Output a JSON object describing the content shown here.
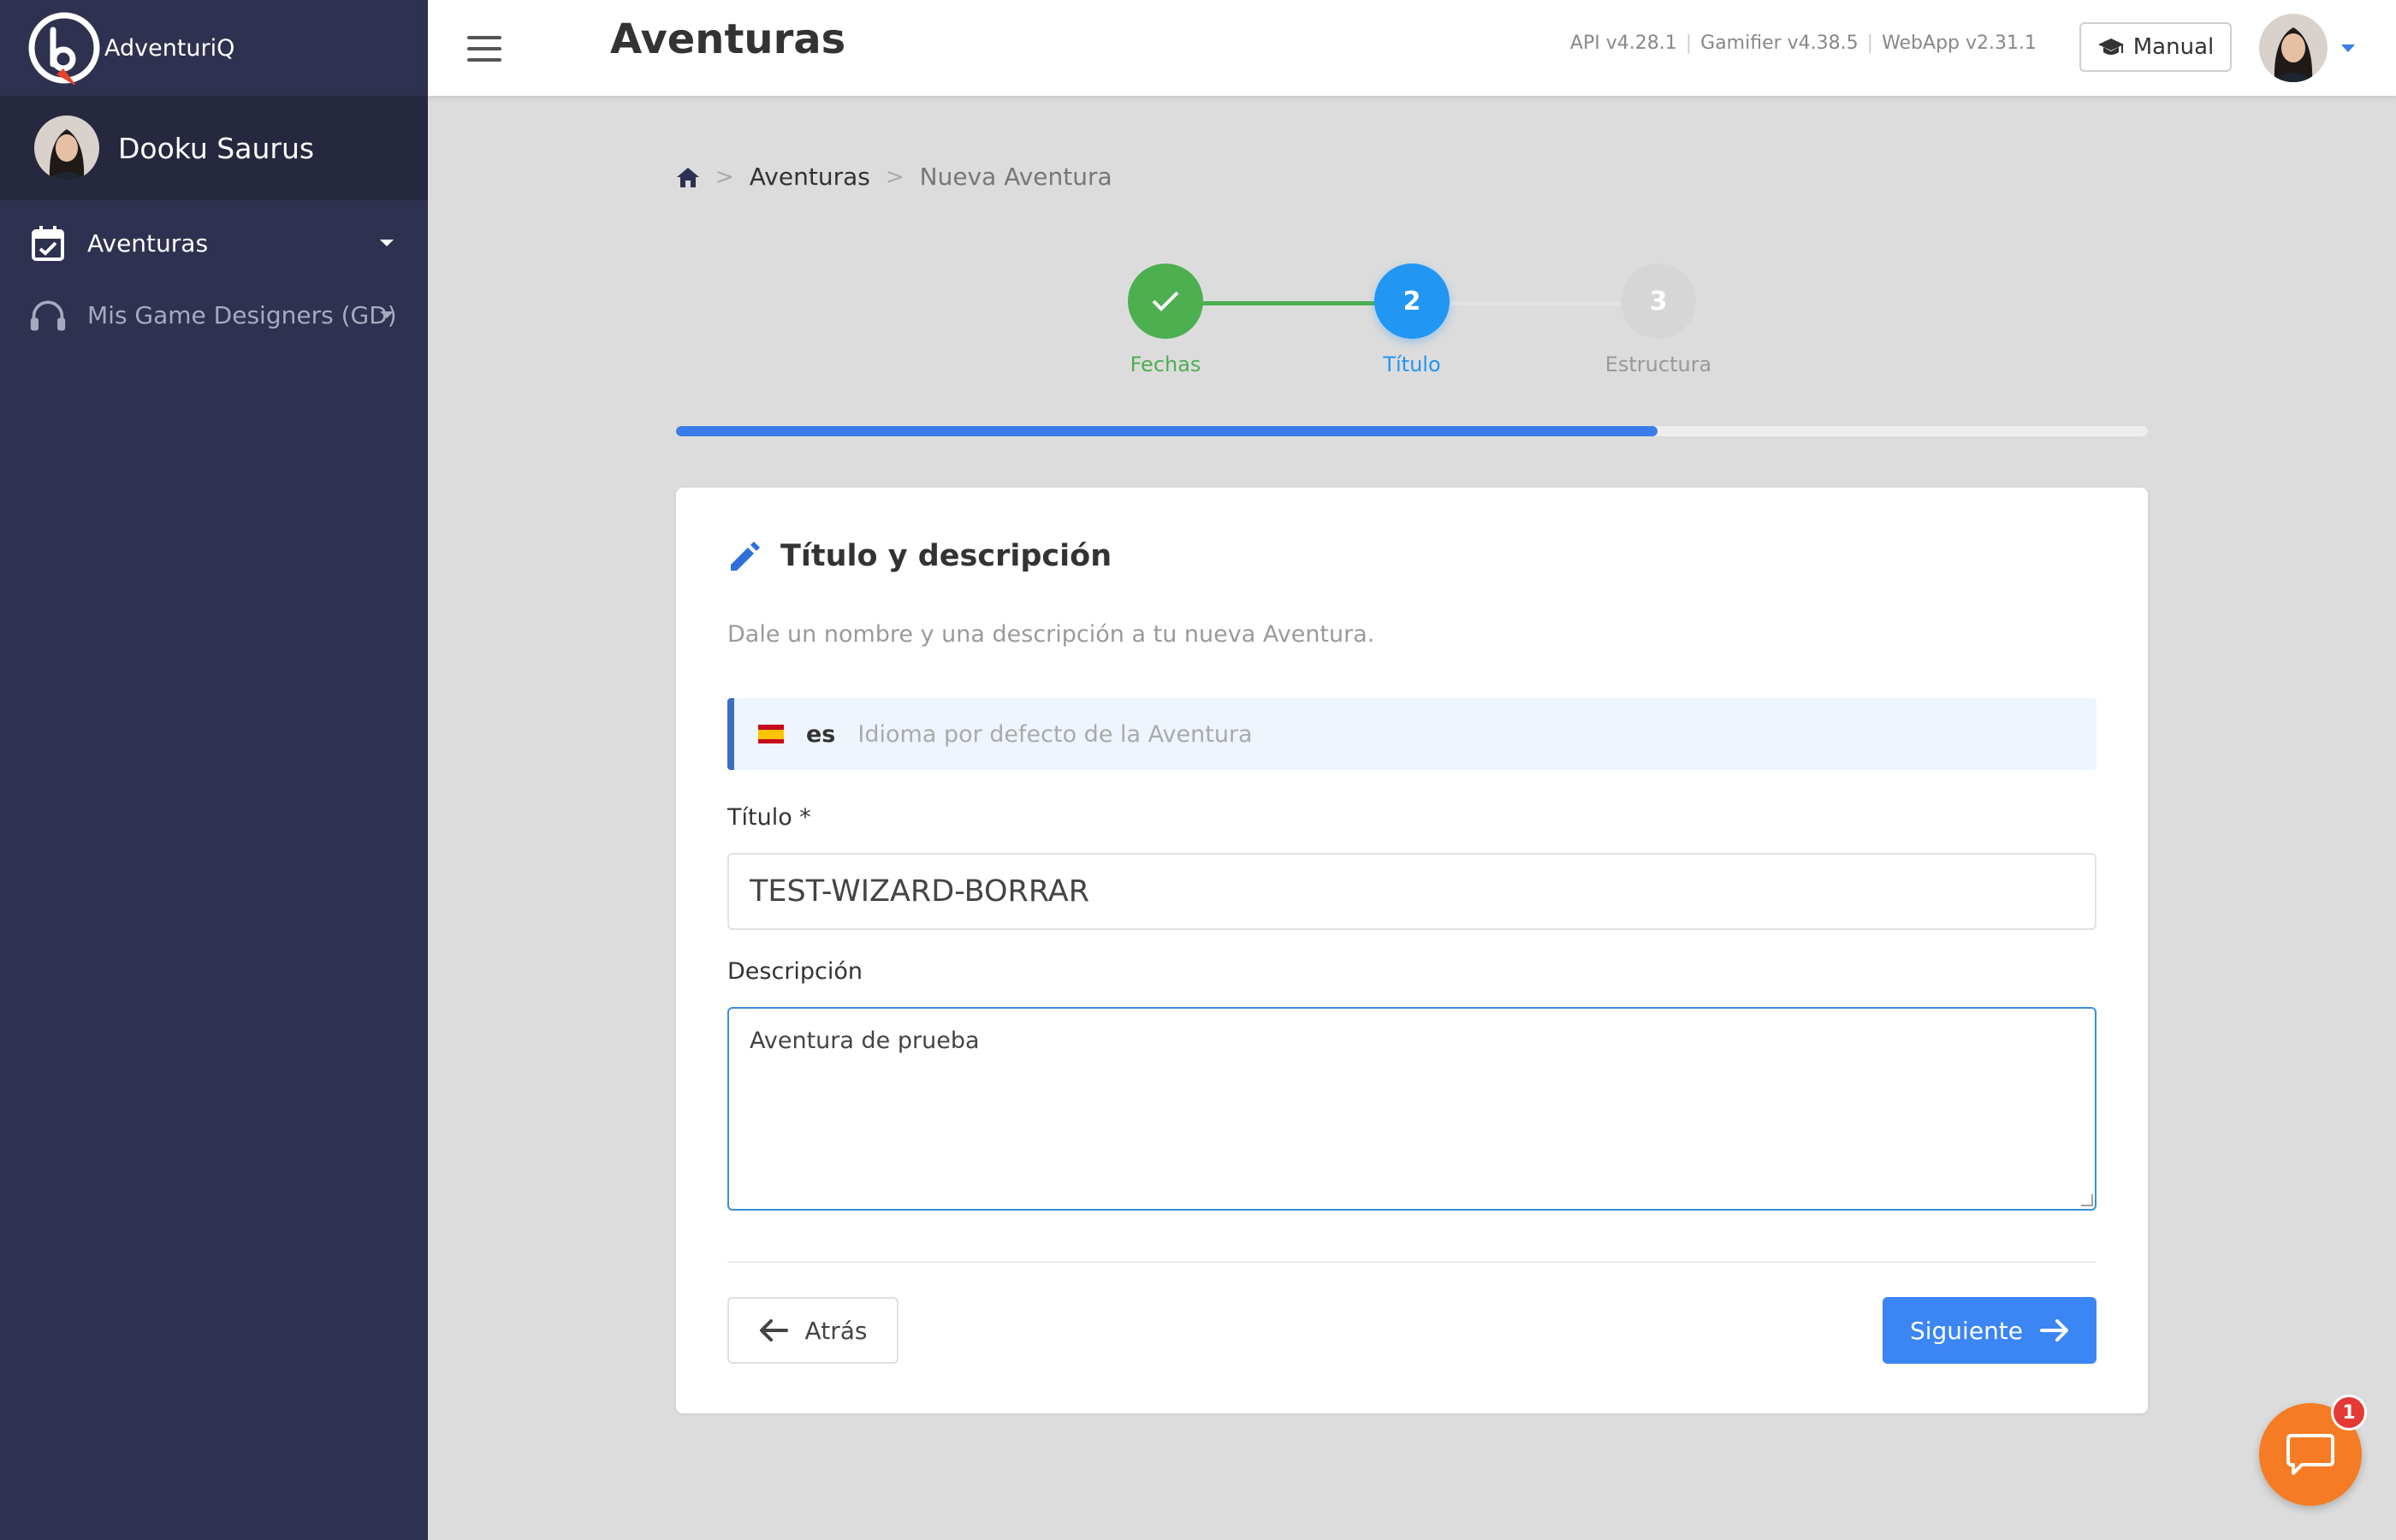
{
  "app": {
    "name": "AdventuriQ"
  },
  "sidebar": {
    "user_name": "Dooku Saurus",
    "items": [
      {
        "label": "Aventuras",
        "icon": "calendar-check-icon"
      },
      {
        "label": "Mis Game Designers (GD)",
        "icon": "headphones-icon"
      }
    ]
  },
  "header": {
    "title": "Aventuras",
    "versions": [
      "API v4.28.1",
      "Gamifier v4.38.5",
      "WebApp v2.31.1"
    ],
    "manual_label": "Manual",
    "accent_color": "#3b7de8"
  },
  "breadcrumb": {
    "home_icon": "home-icon",
    "items": [
      "Aventuras",
      "Nueva Aventura"
    ]
  },
  "stepper": {
    "steps": [
      {
        "label": "Fechas",
        "number": "✓",
        "state": "completed",
        "color": "#4caf50"
      },
      {
        "label": "Título",
        "number": "2",
        "state": "active",
        "color": "#2196f3"
      },
      {
        "label": "Estructura",
        "number": "3",
        "state": "pending",
        "color": "#d6d6d6"
      }
    ],
    "progress_percent": 66.7
  },
  "form": {
    "title": "Título y descripción",
    "subtitle": "Dale un nombre y una descripción a tu nueva Aventura.",
    "language_code": "es",
    "language_desc": "Idioma por defecto de la Aventura",
    "title_label": "Título *",
    "title_value": "TEST-WIZARD-BORRAR",
    "description_label": "Descripción",
    "description_value": "Aventura de prueba",
    "back_label": "Atrás",
    "next_label": "Siguiente"
  },
  "chat": {
    "badge_count": "1",
    "color": "#f57c24"
  }
}
